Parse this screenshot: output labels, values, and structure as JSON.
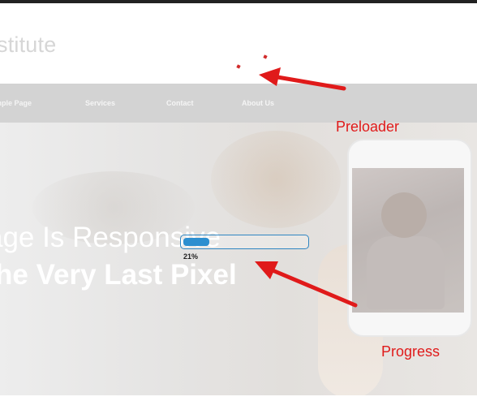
{
  "header": {
    "logo_text": "stitute"
  },
  "nav": {
    "items": [
      "mple Page",
      "Services",
      "Contact",
      "About Us"
    ]
  },
  "hero": {
    "line1": "age Is Responsive",
    "line2": "he Very Last Pixel"
  },
  "progress": {
    "label": "21%",
    "value": 0.21
  },
  "annotations": {
    "preloader": "Preloader",
    "progress": "Progress"
  },
  "colors": {
    "accent": "#2d8fd0",
    "annotation": "#e01a1a",
    "nav_bg": "#d3d3d3"
  }
}
